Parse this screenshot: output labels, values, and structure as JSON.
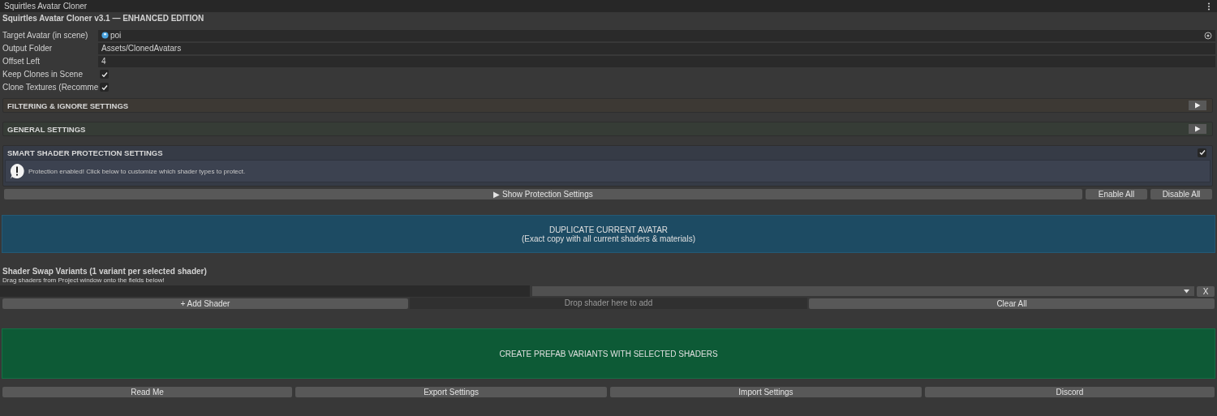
{
  "window": {
    "title": "Squirtles Avatar Cloner"
  },
  "header": "Squirtles Avatar Cloner v3.1 — ENHANCED EDITION",
  "fields": [
    {
      "kind": "object",
      "label": "Target Avatar (in scene)",
      "value": "poi"
    },
    {
      "kind": "text",
      "label": "Output Folder",
      "value": "Assets/ClonedAvatars"
    },
    {
      "kind": "text",
      "label": "Offset Left",
      "value": "4"
    },
    {
      "kind": "checkbox",
      "label": "Keep Clones in Scene",
      "checked": true
    },
    {
      "kind": "checkbox",
      "label": "Clone Textures (Recomme",
      "checked": true
    }
  ],
  "sections": [
    {
      "kind": "foldout",
      "title": "FILTERING & IGNORE SETTINGS",
      "color": "#3d3934",
      "expanded": false
    },
    {
      "kind": "foldout",
      "title": "GENERAL SETTINGS",
      "color": "#363c36",
      "expanded": false
    },
    {
      "kind": "toggle",
      "title": "SMART SHADER PROTECTION SETTINGS",
      "color": "#363b46",
      "checked": true,
      "message": "Protection enabled! Click below to customize which shader types to protect."
    }
  ],
  "protection_buttons": {
    "show": "▶ Show Protection Settings",
    "enable": "Enable All",
    "disable": "Disable All"
  },
  "duplicate_button": {
    "title": "DUPLICATE CURRENT AVATAR",
    "subtitle": "(Exact copy with all current shaders & materials)"
  },
  "shader_swap": {
    "title": "Shader Swap Variants (1 variant per selected shader)",
    "hint": "Drag shaders from Project window onto the fields below!",
    "remove": "X",
    "add": "+ Add Shader",
    "drop": "Drop shader here to add",
    "clear": "Clear All"
  },
  "create_button": "CREATE PREFAB VARIANTS WITH SELECTED SHADERS",
  "footer_buttons": [
    "Read Me",
    "Export Settings",
    "Import Settings",
    "Discord"
  ]
}
